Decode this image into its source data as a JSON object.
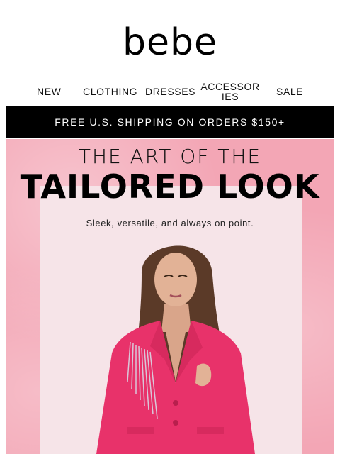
{
  "brand": {
    "logo_text": "bebe"
  },
  "nav": {
    "items": [
      {
        "label": "NEW"
      },
      {
        "label": "CLOTHING"
      },
      {
        "label": "DRESSES"
      },
      {
        "label": "ACCESSORIES"
      },
      {
        "label": "SALE"
      }
    ]
  },
  "promo": {
    "text": "FREE U.S. SHIPPING ON ORDERS $150+"
  },
  "hero": {
    "headline_top": "THE ART OF THE",
    "headline_main": "TAILORED LOOK",
    "subheadline": "Sleek, versatile, and always on point.",
    "colors": {
      "background": "#f3a6b5",
      "panel": "#f6e4e8",
      "blazer": "#e8326a"
    }
  }
}
